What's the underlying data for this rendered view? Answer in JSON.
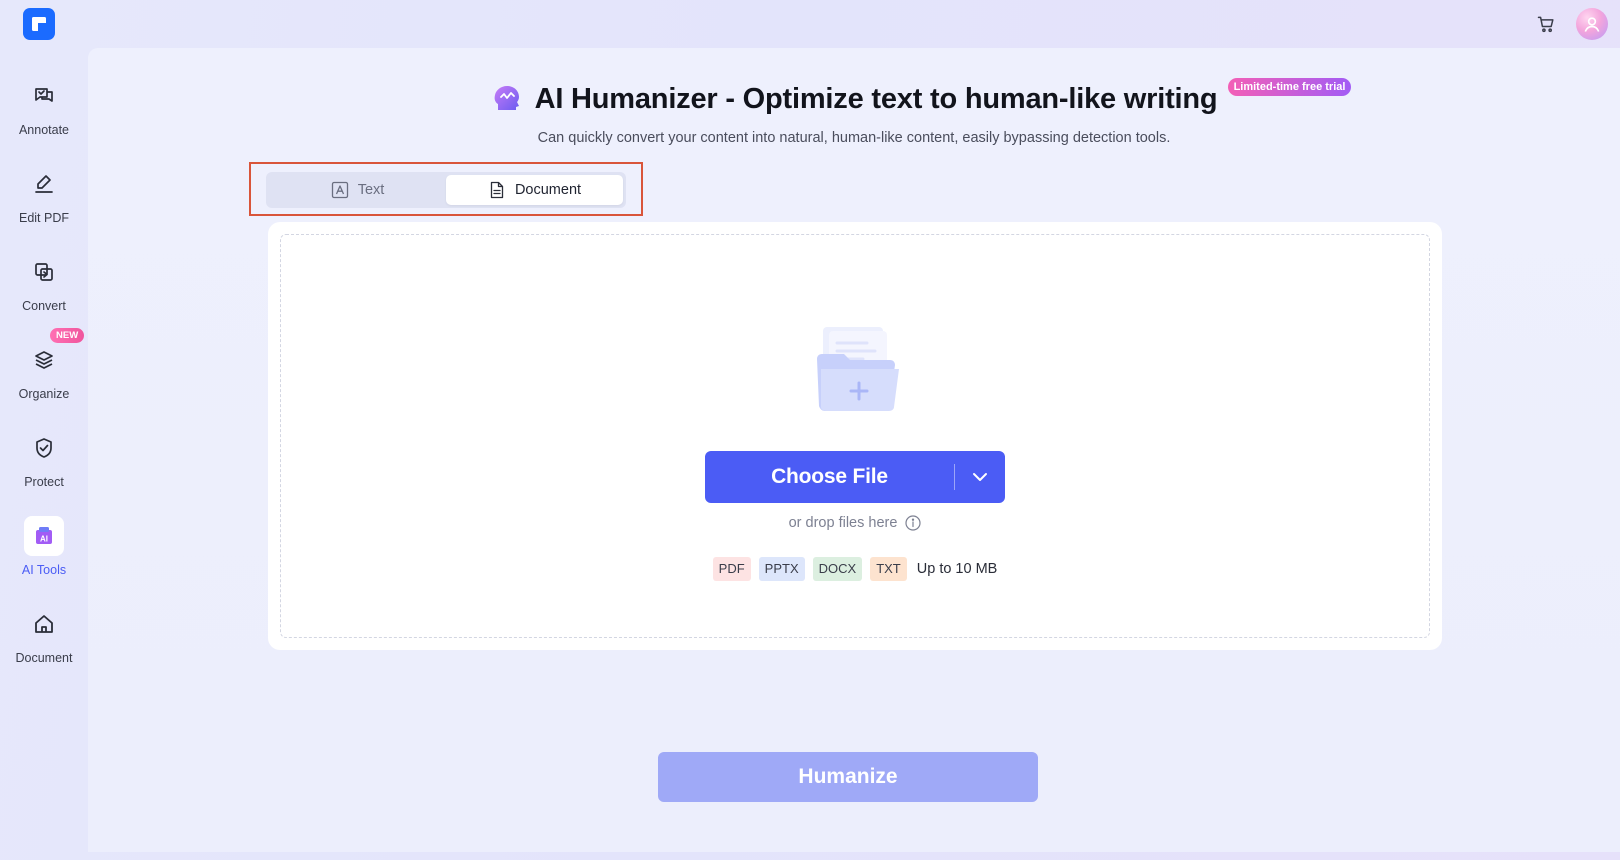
{
  "app": {
    "logo_icon": "app-logo-icon",
    "accent": "#4b5cf5"
  },
  "topbar": {
    "cart_icon": "cart-icon",
    "avatar_icon": "avatar-icon"
  },
  "sidebar": {
    "items": [
      {
        "label": "Annotate",
        "icon": "annotate-icon"
      },
      {
        "label": "Edit PDF",
        "icon": "edit-pdf-icon"
      },
      {
        "label": "Convert",
        "icon": "convert-icon"
      },
      {
        "label": "Organize",
        "icon": "organize-icon",
        "badge": "NEW"
      },
      {
        "label": "Protect",
        "icon": "protect-icon"
      },
      {
        "label": "AI Tools",
        "icon": "ai-tools-icon",
        "active": true
      },
      {
        "label": "Document",
        "icon": "home-icon"
      }
    ]
  },
  "header": {
    "title": "AI Humanizer - Optimize text to human-like writing",
    "badge": "Limited-time free trial",
    "subtitle": "Can quickly convert your content into natural, human-like content, easily bypassing detection tools."
  },
  "tabs": [
    {
      "label": "Text",
      "icon": "text-icon",
      "active": false
    },
    {
      "label": "Document",
      "icon": "document-icon",
      "active": true
    }
  ],
  "upload": {
    "choose_label": "Choose File",
    "drop_hint": "or drop files here",
    "formats": [
      "PDF",
      "PPTX",
      "DOCX",
      "TXT"
    ],
    "size_limit": "Up to 10 MB"
  },
  "actions": {
    "humanize_label": "Humanize"
  }
}
